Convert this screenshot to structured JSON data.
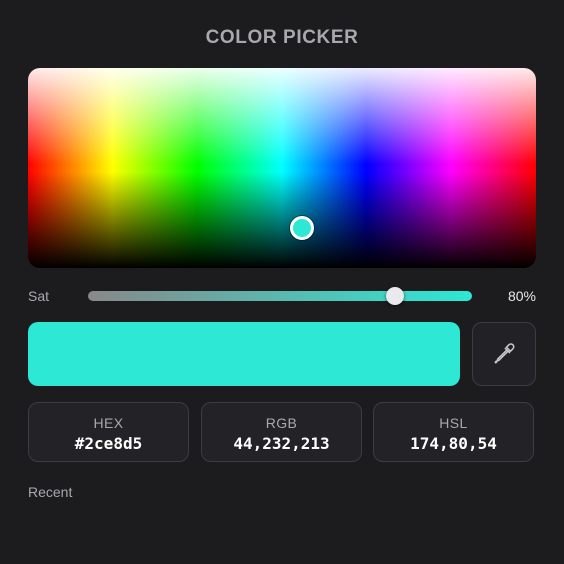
{
  "title": "COLOR PICKER",
  "current_color": "#2ce8d5",
  "saturation": {
    "label": "Sat",
    "display": "80%",
    "fraction": 0.8,
    "track_from": "#888888",
    "track_to": "#2ce8d5"
  },
  "eyedropper": {
    "icon": "eyedropper-icon"
  },
  "values": [
    {
      "label": "HEX",
      "value": "#2ce8d5"
    },
    {
      "label": "RGB",
      "value": "44,232,213"
    },
    {
      "label": "HSL",
      "value": "174,80,54"
    }
  ],
  "recent": {
    "label": "Recent"
  }
}
